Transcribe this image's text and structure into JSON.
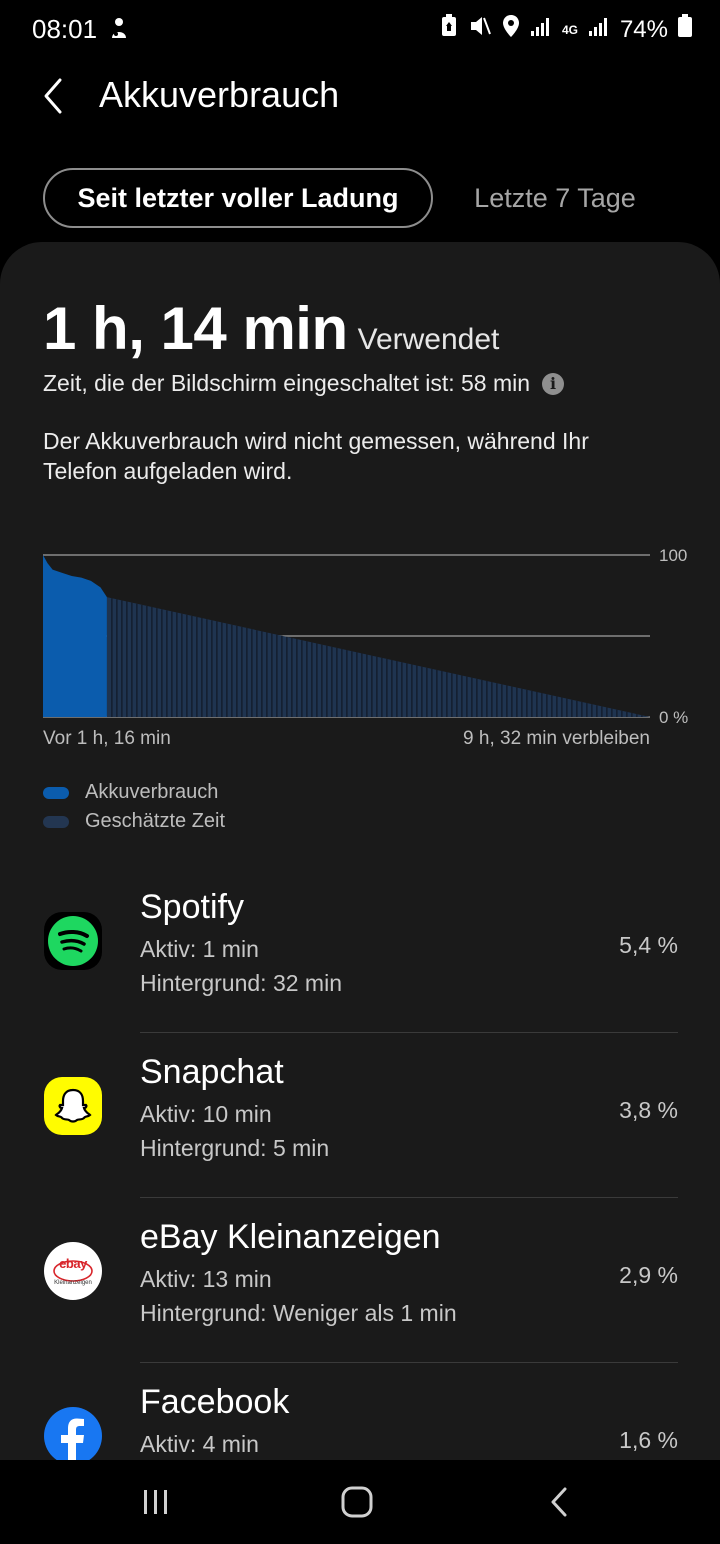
{
  "status_bar": {
    "time": "08:01",
    "network": "4G",
    "battery": "74%"
  },
  "header": {
    "title": "Akkuverbrauch"
  },
  "tabs": [
    {
      "label": "Seit letzter voller Ladung",
      "selected": true
    },
    {
      "label": "Letzte 7 Tage",
      "selected": false
    }
  ],
  "summary": {
    "usage_time": "1 h, 14 min",
    "usage_unit": "Verwendet",
    "screen_time": "Zeit, die der Bildschirm eingeschaltet ist: 58 min",
    "notice": "Der Akkuverbrauch wird nicht gemessen, während Ihr Telefon aufgeladen wird."
  },
  "chart_data": {
    "type": "area",
    "x_start_label": "Vor 1 h, 16 min",
    "x_end_label": "9 h, 32 min verbleiben",
    "y_tick_labels": [
      "100",
      "0 %"
    ],
    "ylim": [
      0,
      100
    ],
    "grid": true,
    "series": [
      {
        "name": "Akkuverbrauch",
        "color": "#0b5cad",
        "x": [
          0,
          0.07,
          0.15,
          0.3,
          0.45,
          0.6,
          0.75,
          0.9,
          1.0
        ],
        "y": [
          100,
          95,
          91,
          89,
          87,
          86,
          84,
          80,
          74
        ]
      },
      {
        "name": "Geschätzte Zeit",
        "color": "#1f3450",
        "x": [
          1.0,
          9.5
        ],
        "y": [
          74,
          0
        ]
      }
    ],
    "legend_position": "bottom-left"
  },
  "legend": [
    {
      "label": "Akkuverbrauch",
      "color": "#0b5cad"
    },
    {
      "label": "Geschätzte Zeit",
      "color": "#233651"
    }
  ],
  "apps": [
    {
      "name": "Spotify",
      "active": "Aktiv: 1 min",
      "background": "Hintergrund: 32 min",
      "percent": "5,4 %",
      "icon": "spotify-icon"
    },
    {
      "name": "Snapchat",
      "active": "Aktiv: 10 min",
      "background": "Hintergrund: 5 min",
      "percent": "3,8 %",
      "icon": "snapchat-icon"
    },
    {
      "name": "eBay Kleinanzeigen",
      "active": "Aktiv: 13 min",
      "background": "Hintergrund: Weniger als 1 min",
      "percent": "2,9 %",
      "icon": "ebay-kleinanzeigen-icon",
      "icon_text": "ebay",
      "icon_subtext": "Kleinanzeigen"
    },
    {
      "name": "Facebook",
      "active": "Aktiv: 4 min",
      "background": "",
      "percent": "1,6 %",
      "icon": "facebook-icon"
    }
  ],
  "colors": {
    "background": "#000000",
    "card": "#1a1a1a",
    "usage_bar": "#0b5cad",
    "estimate": "#1f3450"
  }
}
